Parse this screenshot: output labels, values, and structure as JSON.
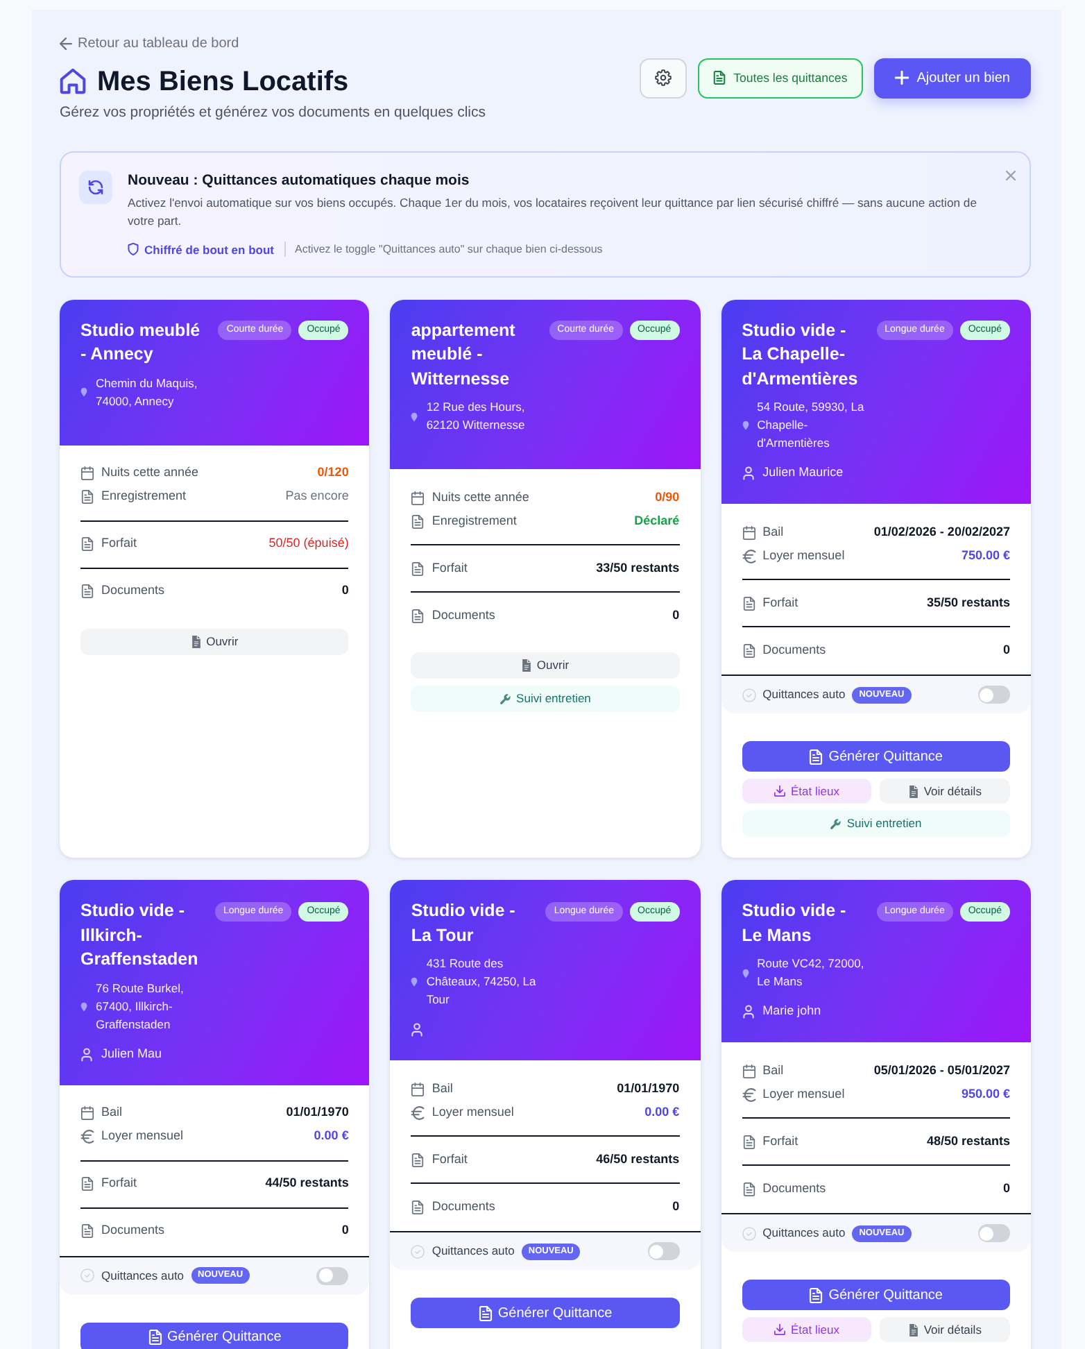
{
  "back_link": "Retour au tableau de bord",
  "page": {
    "title": "Mes Biens Locatifs",
    "subtitle": "Gérez vos propriétés et générez vos documents en quelques clics"
  },
  "header_buttons": [
    {
      "kind": "settings"
    },
    {
      "kind": "receipts",
      "label": "Toutes les quittances"
    },
    {
      "kind": "add",
      "label": "Ajouter un bien"
    }
  ],
  "banner": {
    "title": "Nouveau : Quittances automatiques chaque mois",
    "text": "Activez l'envoi automatique sur vos biens occupés. Chaque 1er du mois, vos locataires reçoivent leur quittance par lien sécurisé chiffré — sans aucune action de votre part.",
    "security": "Chiffré de bout en bout",
    "hint": "Activez le toggle \"Quittances auto\" sur chaque bien ci-dessous",
    "dismissible": true
  },
  "cards": [
    {
      "title": "Studio meublé - Annecy",
      "lease_type": "Courte durée",
      "status": "Occupé",
      "address": "Chemin du Maquis, 74000, Annecy",
      "tenant_line": false,
      "stat_groups": [
        {
          "rows": [
            {
              "kind": "nights",
              "label": "Nuits cette année",
              "value": "0/120",
              "color": "#ea580c",
              "bold": true
            },
            {
              "kind": "registration",
              "label": "Enregistrement",
              "value": "Pas encore",
              "color": "#6b7280",
              "bold": false
            }
          ]
        },
        {
          "rows": [
            {
              "kind": "quota",
              "label": "Forfait",
              "value": "50/50 (épuisé)",
              "color": "#dc2626",
              "bold": false
            }
          ]
        },
        {
          "rows": [
            {
              "kind": "documents",
              "label": "Documents",
              "value": "0",
              "color": "#111827",
              "bold": true
            }
          ]
        }
      ],
      "buttons": [
        {
          "kind": "open",
          "label": "Ouvrir"
        }
      ]
    },
    {
      "title": "appartement meublé - Witternesse",
      "lease_type": "Courte durée",
      "status": "Occupé",
      "address": "12 Rue des Hours, 62120 Witternesse",
      "tenant_line": false,
      "stat_groups": [
        {
          "rows": [
            {
              "kind": "nights",
              "label": "Nuits cette année",
              "value": "0/90",
              "color": "#ea580c",
              "bold": true
            },
            {
              "kind": "registration",
              "label": "Enregistrement",
              "value": "Déclaré",
              "color": "#16a34a",
              "bold": true
            }
          ]
        },
        {
          "rows": [
            {
              "kind": "quota",
              "label": "Forfait",
              "value": "33/50 restants",
              "color": "#111827",
              "bold": true
            }
          ]
        },
        {
          "rows": [
            {
              "kind": "documents",
              "label": "Documents",
              "value": "0",
              "color": "#111827",
              "bold": true
            }
          ]
        }
      ],
      "buttons": [
        {
          "kind": "open",
          "label": "Ouvrir"
        },
        {
          "kind": "maintenance",
          "label": "Suivi entretien"
        }
      ]
    },
    {
      "title": "Studio vide - La Chapelle-d'Armentières",
      "lease_type": "Longue durée",
      "status": "Occupé",
      "address": "54 Route, 59930, La Chapelle-d'Armentières",
      "tenant_line": true,
      "tenant": "Julien Maurice",
      "stat_groups": [
        {
          "rows": [
            {
              "kind": "lease",
              "label": "Bail",
              "value": "01/02/2026 - 20/02/2027",
              "color": "#111827",
              "bold": true
            },
            {
              "kind": "rent",
              "label": "Loyer mensuel",
              "value": "750.00 €",
              "color": "#4f46e5",
              "bold": true
            }
          ]
        },
        {
          "rows": [
            {
              "kind": "quota",
              "label": "Forfait",
              "value": "35/50 restants",
              "color": "#111827",
              "bold": true
            }
          ]
        },
        {
          "rows": [
            {
              "kind": "documents",
              "label": "Documents",
              "value": "0",
              "color": "#111827",
              "bold": true
            }
          ]
        }
      ],
      "auto_receipts": {
        "label": "Quittances auto",
        "badge": "NOUVEAU",
        "on": false
      },
      "buttons": [
        {
          "kind": "primary",
          "label": "Générer Quittance"
        },
        {
          "kind": "inventory",
          "label": "État lieux"
        },
        {
          "kind": "details",
          "label": "Voir détails"
        },
        {
          "kind": "maintenance",
          "label": "Suivi entretien"
        }
      ]
    },
    {
      "title": "Studio vide - Illkirch-Graffenstaden",
      "lease_type": "Longue durée",
      "status": "Occupé",
      "address": "76 Route Burkel, 67400, Illkirch-Graffenstaden",
      "tenant_line": true,
      "tenant": "Julien Mau",
      "stat_groups": [
        {
          "rows": [
            {
              "kind": "lease",
              "label": "Bail",
              "value": "01/01/1970",
              "color": "#111827",
              "bold": true
            },
            {
              "kind": "rent",
              "label": "Loyer mensuel",
              "value": "0.00 €",
              "color": "#4f46e5",
              "bold": true
            }
          ]
        },
        {
          "rows": [
            {
              "kind": "quota",
              "label": "Forfait",
              "value": "44/50 restants",
              "color": "#111827",
              "bold": true
            }
          ]
        },
        {
          "rows": [
            {
              "kind": "documents",
              "label": "Documents",
              "value": "0",
              "color": "#111827",
              "bold": true
            }
          ]
        }
      ],
      "auto_receipts": {
        "label": "Quittances auto",
        "badge": "NOUVEAU",
        "on": false
      },
      "buttons": [
        {
          "kind": "primary",
          "label": "Générer Quittance"
        }
      ]
    },
    {
      "title": "Studio vide - La Tour",
      "lease_type": "Longue durée",
      "status": "Occupé",
      "address": "431 Route des Châteaux, 74250, La Tour",
      "tenant_line": true,
      "stat_groups": [
        {
          "rows": [
            {
              "kind": "lease",
              "label": "Bail",
              "value": "01/01/1970",
              "color": "#111827",
              "bold": true
            },
            {
              "kind": "rent",
              "label": "Loyer mensuel",
              "value": "0.00 €",
              "color": "#4f46e5",
              "bold": true
            }
          ]
        },
        {
          "rows": [
            {
              "kind": "quota",
              "label": "Forfait",
              "value": "46/50 restants",
              "color": "#111827",
              "bold": true
            }
          ]
        },
        {
          "rows": [
            {
              "kind": "documents",
              "label": "Documents",
              "value": "0",
              "color": "#111827",
              "bold": true
            }
          ]
        }
      ],
      "auto_receipts": {
        "label": "Quittances auto",
        "badge": "NOUVEAU",
        "on": false
      },
      "buttons": [
        {
          "kind": "primary",
          "label": "Générer Quittance"
        }
      ]
    },
    {
      "title": "Studio vide - Le Mans",
      "lease_type": "Longue durée",
      "status": "Occupé",
      "address": "Route VC42, 72000, Le Mans",
      "tenant_line": true,
      "tenant": "Marie john",
      "stat_groups": [
        {
          "rows": [
            {
              "kind": "lease",
              "label": "Bail",
              "value": "05/01/2026 - 05/01/2027",
              "color": "#111827",
              "bold": true
            },
            {
              "kind": "rent",
              "label": "Loyer mensuel",
              "value": "950.00 €",
              "color": "#4f46e5",
              "bold": true
            }
          ]
        },
        {
          "rows": [
            {
              "kind": "quota",
              "label": "Forfait",
              "value": "48/50 restants",
              "color": "#111827",
              "bold": true
            }
          ]
        },
        {
          "rows": [
            {
              "kind": "documents",
              "label": "Documents",
              "value": "0",
              "color": "#111827",
              "bold": true
            }
          ]
        }
      ],
      "auto_receipts": {
        "label": "Quittances auto",
        "badge": "NOUVEAU",
        "on": false
      },
      "buttons": [
        {
          "kind": "primary",
          "label": "Générer Quittance"
        },
        {
          "kind": "inventory",
          "label": "État lieux"
        },
        {
          "kind": "details",
          "label": "Voir détails"
        }
      ]
    }
  ]
}
